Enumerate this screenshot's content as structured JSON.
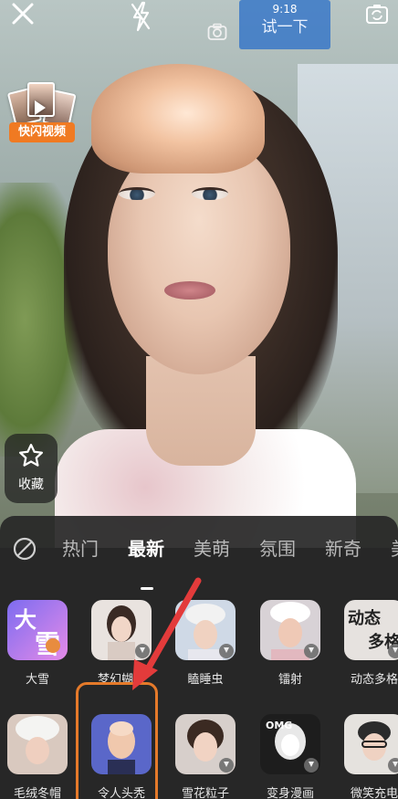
{
  "top_bar": {
    "time": "9:18",
    "try_label": "试一下"
  },
  "sticker": {
    "label": "快闪视频"
  },
  "favorite": {
    "label": "收藏"
  },
  "tabs": [
    "热门",
    "最新",
    "美萌",
    "氛围",
    "新奇",
    "美"
  ],
  "active_tab": "最新",
  "effects": [
    {
      "label": "大雪",
      "icon": "snow-effect-thumb"
    },
    {
      "label": "梦幻蝴蝶",
      "icon": "dream-butterfly-thumb"
    },
    {
      "label": "瞌睡虫",
      "icon": "sleepy-bug-thumb"
    },
    {
      "label": "镭射",
      "icon": "laser-thumb"
    },
    {
      "label": "动态多格",
      "icon": "dynamic-grid-thumb"
    },
    {
      "label": "毛绒冬帽",
      "icon": "winter-hat-thumb"
    },
    {
      "label": "令人头秃",
      "icon": "bald-head-thumb"
    },
    {
      "label": "雪花粒子",
      "icon": "snow-particle-thumb"
    },
    {
      "label": "变身漫画",
      "icon": "comic-thumb"
    },
    {
      "label": "微笑充电",
      "icon": "smile-charge-thumb"
    }
  ],
  "thumb_text": {
    "snow_big": "大",
    "snow_small": "雪",
    "dynamic_top": "动态",
    "dynamic_bottom": "多格",
    "omg": "OMG"
  },
  "colors": {
    "accent_orange": "#f07a22",
    "selected_border": "#e57a2a",
    "arrow_red": "#e33b3b",
    "try_bg": "#2f6fd0"
  }
}
